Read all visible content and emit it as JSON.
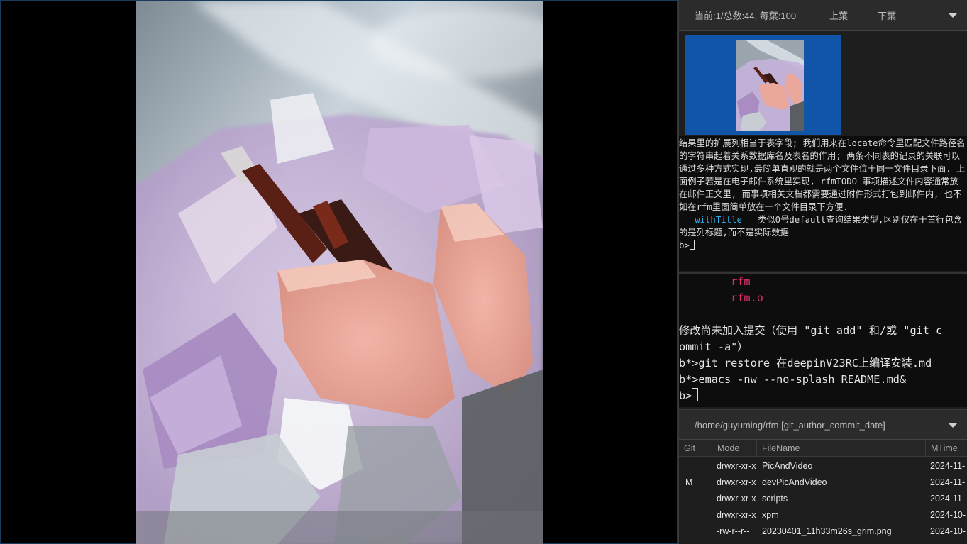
{
  "viewer": {
    "image_alt": "macro photo of pink and purple crystals with dark needle crystals"
  },
  "pager": {
    "info": "当前:1/总数:44, 每葉:100",
    "prev_label": "上葉",
    "next_label": "下葉"
  },
  "term1": {
    "text_before": "结果里的扩展列相当于表字段; 我们用来在locate命令里匹配文件路径名的字符串起着关系数据库名及表名的作用; 两条不同表的记录的关联可以通过多种方式实现,最简单直观的就是两个文件位于同一文件目录下面. 上面例子若是在电子邮件系统里实现, rfmTODO 事项描述文件内容通常放在邮件正文里, 而事项相关文档都需要通过附件形式打包到邮件内, 也不如在rfm里面简单放在一个文件目录下方便.\n   ",
    "keyword": "withTitle",
    "text_after": "   类似0号default查询结果类型,区别仅在于首行包含的是列标题,而不是实际数据\n",
    "prompt": "b>"
  },
  "term2": {
    "lines": [
      {
        "text": "        rfm",
        "red": true
      },
      {
        "text": "        rfm.o",
        "red": true
      },
      {
        "text": "",
        "red": false
      },
      {
        "text": "修改尚未加入提交（使用 \"git add\" 和/或 \"git c",
        "red": false
      },
      {
        "text": "ommit -a\"）",
        "red": false
      },
      {
        "text": "b*>git restore 在deepinV23RC上编译安装.md",
        "red": false
      },
      {
        "text": "b*>emacs -nw --no-splash README.md&",
        "red": false
      }
    ],
    "prompt": "b>"
  },
  "pathbar": {
    "path": "/home/guyuming/rfm [git_author_commit_date]"
  },
  "filetable": {
    "headers": {
      "git": "Git",
      "mode": "Mode",
      "name": "FileName",
      "mtime": "MTime"
    },
    "rows": [
      {
        "git": "",
        "mode": "drwxr-xr-x",
        "name": "PicAndVideo",
        "mtime": "2024-11-"
      },
      {
        "git": "M",
        "mode": "drwxr-xr-x",
        "name": "devPicAndVideo",
        "mtime": "2024-11-"
      },
      {
        "git": "",
        "mode": "drwxr-xr-x",
        "name": "scripts",
        "mtime": "2024-11-"
      },
      {
        "git": "",
        "mode": "drwxr-xr-x",
        "name": "xpm",
        "mtime": "2024-10-"
      },
      {
        "git": "",
        "mode": "-rw-r--r--",
        "name": "20230401_11h33m26s_grim.png",
        "mtime": "2024-10-"
      }
    ]
  },
  "colors": {
    "thumb_tile": "#1155a8",
    "keyword": "#34b0e8",
    "untracked_red": "#e0306a"
  }
}
